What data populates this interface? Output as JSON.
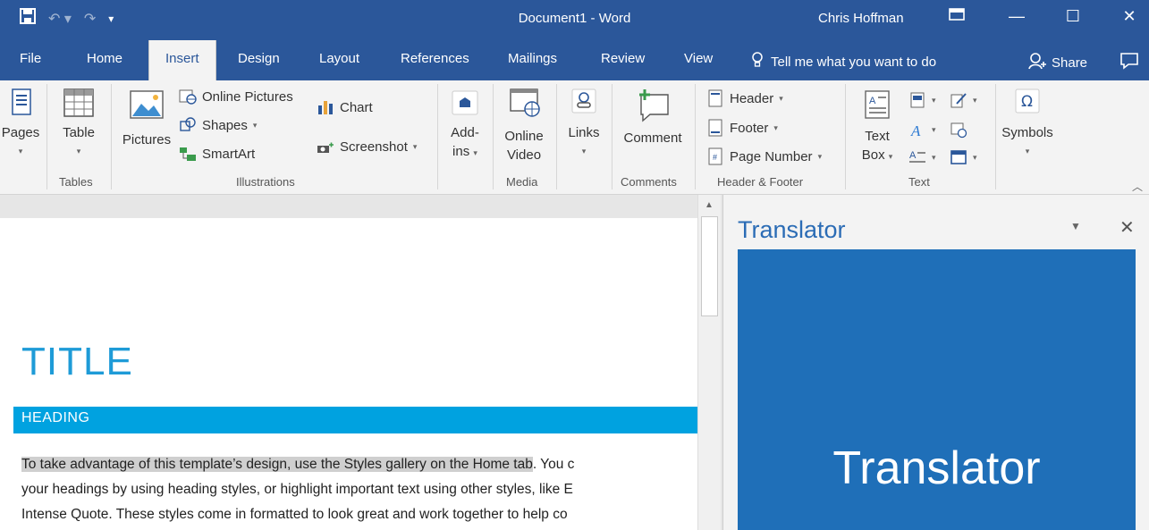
{
  "titlebar": {
    "doc_title": "Document1 - Word",
    "user": "Chris Hoffman",
    "colors": {
      "brand": "#2b579a"
    }
  },
  "tabs": [
    {
      "label": "File"
    },
    {
      "label": "Home"
    },
    {
      "label": "Insert",
      "active": true
    },
    {
      "label": "Design"
    },
    {
      "label": "Layout"
    },
    {
      "label": "References"
    },
    {
      "label": "Mailings"
    },
    {
      "label": "Review"
    },
    {
      "label": "View"
    }
  ],
  "tellme": "Tell me what you want to do",
  "share": "Share",
  "ribbon": {
    "pages": {
      "label": "Pages"
    },
    "tables": {
      "table": "Table",
      "group": "Tables"
    },
    "illustrations": {
      "pictures": "Pictures",
      "online_pictures": "Online Pictures",
      "shapes": "Shapes",
      "smartart": "SmartArt",
      "chart": "Chart",
      "screenshot": "Screenshot",
      "group": "Illustrations"
    },
    "addins": {
      "line1": "Add-",
      "line2": "ins"
    },
    "media": {
      "line1": "Online",
      "line2": "Video",
      "group": "Media"
    },
    "links": {
      "label": "Links"
    },
    "comments": {
      "comment": "Comment",
      "group": "Comments"
    },
    "header_footer": {
      "header": "Header",
      "footer": "Footer",
      "page_number": "Page Number",
      "group": "Header & Footer"
    },
    "text": {
      "line1": "Text",
      "line2": "Box",
      "group": "Text"
    },
    "symbols": {
      "label": "Symbols"
    }
  },
  "document": {
    "title": "TITLE",
    "heading": "HEADING",
    "line1_highlight": "To take advantage of this template’s design, use the Styles gallery on the Home tab",
    "line1_rest": ". You c",
    "line2": "your headings by using heading styles, or highlight important text using other styles, like E",
    "line3": "Intense Quote. These styles come in formatted to look great and work together to help co"
  },
  "pane": {
    "title": "Translator",
    "tile_text": "Translator",
    "colors": {
      "title": "#2b6cb5",
      "tile": "#1f6fb8"
    }
  },
  "icons": [
    "save-icon",
    "undo-icon",
    "redo-icon",
    "customize-qat-icon",
    "ribbon-display-icon",
    "minimize-icon",
    "maximize-icon",
    "close-icon",
    "lightbulb-icon",
    "share-person-icon",
    "comment-bubble-icon"
  ]
}
